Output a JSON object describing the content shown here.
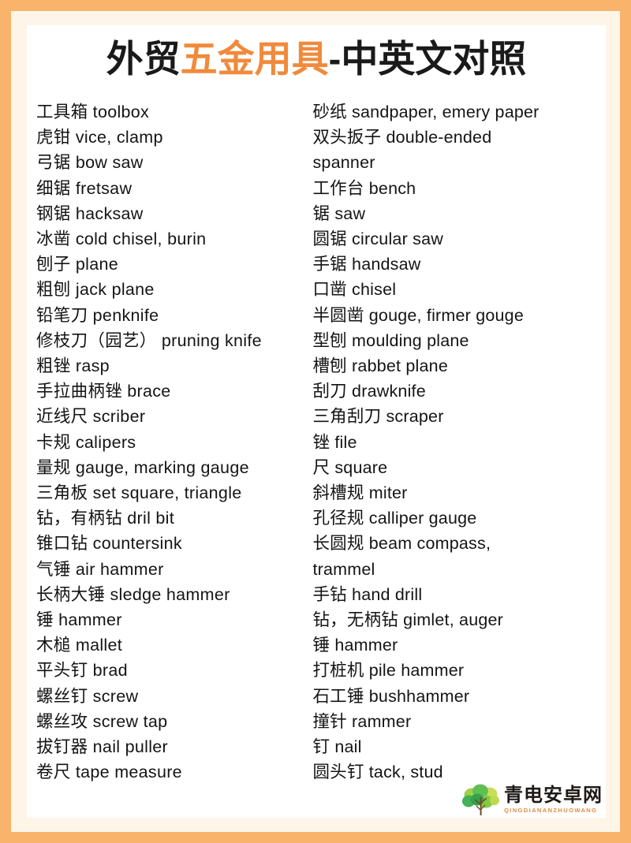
{
  "title": {
    "part1": "外贸",
    "part2": "五金用具",
    "part3": "-中英文对照",
    "accent_color": "#f08a3c",
    "text_color": "#1a1a1a"
  },
  "theme": {
    "border_color": "#f9b36a",
    "inner_border_color": "#fdf6e8",
    "page_background": "#ffffff"
  },
  "columns": {
    "left": [
      "工具箱 toolbox",
      "虎钳 vice, clamp",
      "弓锯 bow saw",
      "细锯 fretsaw",
      "钢锯 hacksaw",
      "冰凿 cold chisel, burin",
      "刨子 plane",
      "粗刨 jack plane",
      "铅笔刀 penknife",
      "修枝刀（园艺） pruning knife",
      "粗锉 rasp",
      "手拉曲柄锉 brace",
      "近线尺 scriber",
      "卡规 calipers",
      "量规 gauge, marking gauge",
      "三角板 set square, triangle",
      "钻，有柄钻 dril bit",
      "锥口钻 countersink",
      "气锤 air hammer",
      "长柄大锤 sledge hammer",
      "锤 hammer",
      "木槌 mallet",
      "平头钉 brad",
      "螺丝钉 screw",
      "螺丝攻 screw tap",
      "拔钉器 nail puller",
      "卷尺 tape measure"
    ],
    "right": [
      "砂纸 sandpaper, emery paper",
      "双头扳子 double-ended",
      "spanner",
      "工作台 bench",
      "锯 saw",
      "圆锯 circular saw",
      "手锯 handsaw",
      "口凿 chisel",
      "半圆凿 gouge, firmer gouge",
      "型刨 moulding plane",
      "槽刨 rabbet plane",
      "刮刀 drawknife",
      "三角刮刀 scraper",
      "锉 file",
      "尺 square",
      "斜槽规 miter",
      "孔径规 calliper gauge",
      "长圆规 beam compass,",
      "trammel",
      "手钻 hand drill",
      "钻，无柄钻 gimlet, auger",
      "锤 hammer",
      "打桩机 pile hammer",
      "石工锤 bushhammer",
      "撞针 rammer",
      "钉 nail",
      "圆头钉 tack, stud"
    ]
  },
  "watermark": {
    "icon": "tree-icon",
    "main_text": "青电安卓网",
    "sub_text": "QINGDIANANZHUOWANG",
    "main_color": "#17120e",
    "sub_color": "#e08a3a"
  }
}
